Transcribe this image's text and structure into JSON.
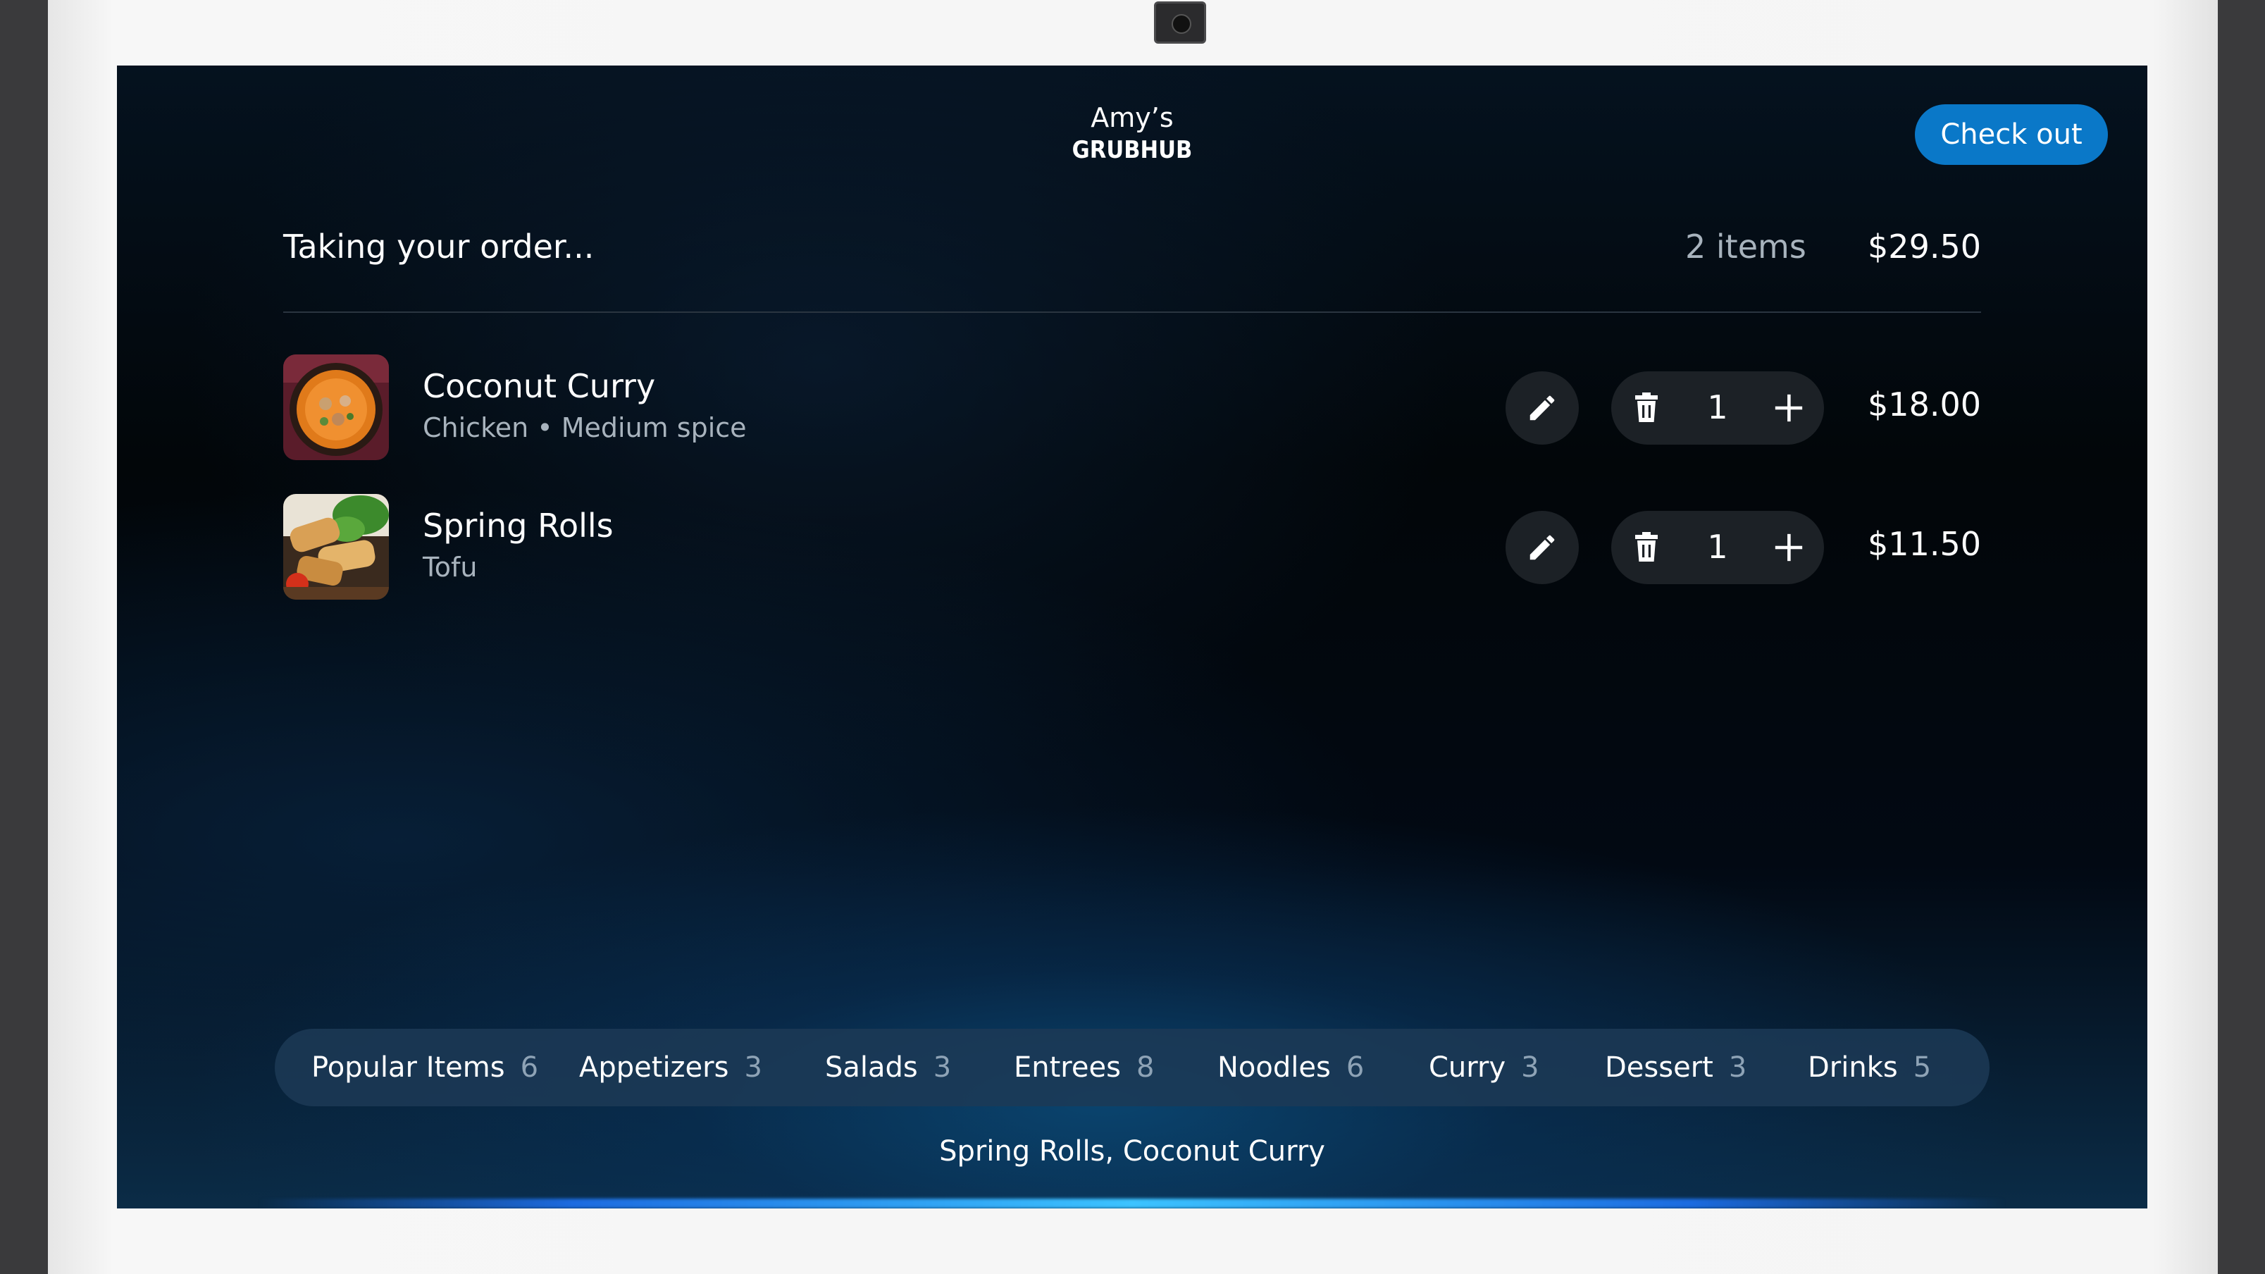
{
  "brand": {
    "name": "Amy’s",
    "logo": "GRUBHUB"
  },
  "header": {
    "checkout_label": "Check out"
  },
  "order": {
    "status": "Taking your order...",
    "item_count": "2 items",
    "total": "$29.50",
    "items": [
      {
        "name": "Coconut Curry",
        "description": "Chicken • Medium spice",
        "quantity": "1",
        "price": "$18.00",
        "image": "coconut-curry-image"
      },
      {
        "name": "Spring Rolls",
        "description": "Tofu",
        "quantity": "1",
        "price": "$11.50",
        "image": "spring-rolls-image"
      }
    ]
  },
  "categories": [
    {
      "label": "Popular Items",
      "count": "6"
    },
    {
      "label": "Appetizers",
      "count": "3"
    },
    {
      "label": "Salads",
      "count": "3"
    },
    {
      "label": "Entrees",
      "count": "8"
    },
    {
      "label": "Noodles",
      "count": "6"
    },
    {
      "label": "Curry",
      "count": "3"
    },
    {
      "label": "Dessert",
      "count": "3"
    },
    {
      "label": "Drinks",
      "count": "5"
    }
  ],
  "utterance": "Spring Rolls, Coconut Curry",
  "icons": {
    "edit": "pencil-icon",
    "delete": "trash-icon",
    "add": "plus-icon"
  },
  "colors": {
    "accent": "#0a78c8",
    "background": "#020609",
    "chip": "#1c2126"
  }
}
